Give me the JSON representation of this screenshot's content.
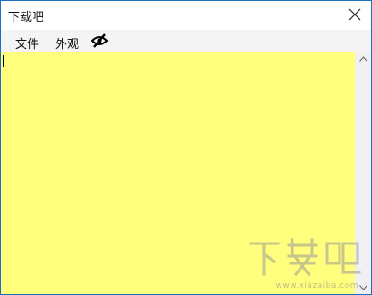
{
  "window": {
    "title": "下载吧",
    "close_icon": "close-icon"
  },
  "menubar": {
    "file_label": "文件",
    "appearance_label": "外观",
    "visibility_icon": "eye-slash-icon"
  },
  "editor": {
    "background_color": "#ffff7d",
    "text": ""
  },
  "watermark": {
    "logo_text": "下载吧",
    "url_text": "www.xiazaiba.com"
  },
  "colors": {
    "window_border": "#1e6fbf",
    "note_yellow": "#ffff7d"
  }
}
